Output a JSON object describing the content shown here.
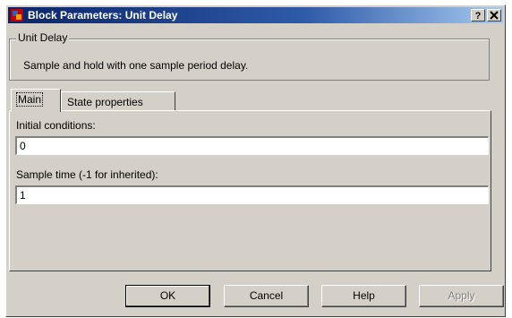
{
  "window": {
    "title": "Block Parameters: Unit Delay",
    "help_glyph": "?",
    "close_glyph": "X",
    "icon": "simulink-block-icon"
  },
  "block": {
    "group_title": "Unit Delay",
    "description": "Sample and hold with one sample period delay."
  },
  "tabs": [
    {
      "label": "Main",
      "selected": true
    },
    {
      "label": "State properties",
      "selected": false
    }
  ],
  "fields": {
    "initial_conditions": {
      "label": "Initial conditions:",
      "value": "0"
    },
    "sample_time": {
      "label": "Sample time (-1 for inherited):",
      "value": "1"
    }
  },
  "buttons": {
    "ok": "OK",
    "cancel": "Cancel",
    "help": "Help",
    "apply": "Apply"
  },
  "colors": {
    "title_gradient_start": "#0a246a",
    "face": "#d4d0c8"
  }
}
